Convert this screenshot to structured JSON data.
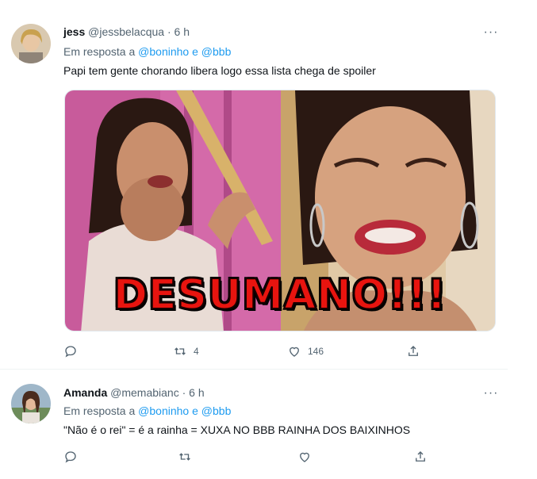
{
  "tweets": [
    {
      "name": "jess",
      "handle": "@jessbelacqua",
      "separator": "·",
      "time": "6 h",
      "reply_prefix": "Em resposta a",
      "mention_1": "@boninho",
      "reply_conj": "e",
      "mention_2": "@bbb",
      "text": "Papi tem gente chorando libera logo essa lista chega de spoiler",
      "media_caption": "DESUMANO!!!",
      "reply_count": "",
      "retweet_count": "4",
      "like_count": "146"
    },
    {
      "name": "Amanda",
      "handle": "@memabianc",
      "separator": "·",
      "time": "6 h",
      "reply_prefix": "Em resposta a",
      "mention_1": "@boninho",
      "reply_conj": "e",
      "mention_2": "@bbb",
      "text": "\"Não é o rei\" = é a rainha = XUXA NO BBB RAINHA DOS BAIXINHOS",
      "reply_count": "",
      "retweet_count": "",
      "like_count": ""
    }
  ],
  "more_glyph": "···",
  "icons": [
    "reply-icon",
    "retweet-icon",
    "like-icon",
    "share-icon",
    "more-icon"
  ],
  "colors": {
    "link": "#1d9bf0",
    "muted": "#536471",
    "caption": "#e8140f"
  }
}
